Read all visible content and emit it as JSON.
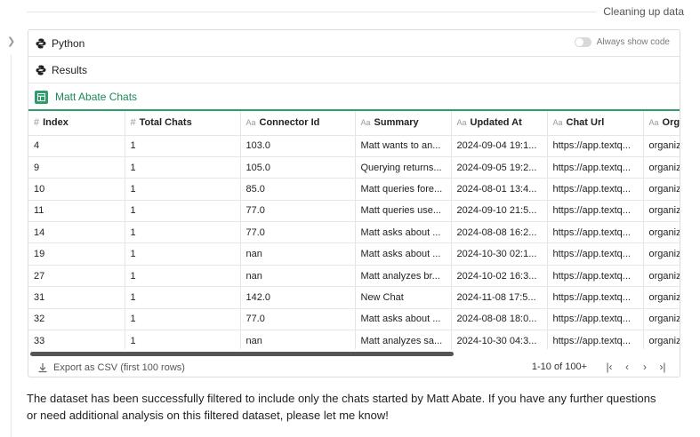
{
  "header": {
    "status": "Cleaning up data"
  },
  "cell": {
    "python_label": "Python",
    "results_label": "Results",
    "always_show_code_label": "Always show code",
    "always_show_code_on": false,
    "table_title": "Matt Abate Chats"
  },
  "table": {
    "columns": [
      {
        "type": "#",
        "label": "Index"
      },
      {
        "type": "#",
        "label": "Total Chats"
      },
      {
        "type": "Aa",
        "label": "Connector Id"
      },
      {
        "type": "Aa",
        "label": "Summary"
      },
      {
        "type": "Aa",
        "label": "Updated At"
      },
      {
        "type": "Aa",
        "label": "Chat Url"
      },
      {
        "type": "Aa",
        "label": "Org"
      }
    ],
    "rows": [
      [
        "4",
        "1",
        "103.0",
        "Matt wants to an...",
        "2024-09-04 19:1...",
        "https://app.textq...",
        "organiz"
      ],
      [
        "9",
        "1",
        "105.0",
        "Querying returns...",
        "2024-09-05 19:2...",
        "https://app.textq...",
        "organiz"
      ],
      [
        "10",
        "1",
        "85.0",
        "Matt queries fore...",
        "2024-08-01 13:4...",
        "https://app.textq...",
        "organiz"
      ],
      [
        "11",
        "1",
        "77.0",
        "Matt queries use...",
        "2024-09-10 21:5...",
        "https://app.textq...",
        "organiz"
      ],
      [
        "14",
        "1",
        "77.0",
        "Matt asks about ...",
        "2024-08-08 16:2...",
        "https://app.textq...",
        "organiz"
      ],
      [
        "19",
        "1",
        "nan",
        "Matt asks about ...",
        "2024-10-30 02:1...",
        "https://app.textq...",
        "organiz"
      ],
      [
        "27",
        "1",
        "nan",
        "Matt analyzes br...",
        "2024-10-02 16:3...",
        "https://app.textq...",
        "organiz"
      ],
      [
        "31",
        "1",
        "142.0",
        "New Chat",
        "2024-11-08 17:5...",
        "https://app.textq...",
        "organiz"
      ],
      [
        "32",
        "1",
        "77.0",
        "Matt asks about ...",
        "2024-08-08 18:0...",
        "https://app.textq...",
        "organiz"
      ],
      [
        "33",
        "1",
        "nan",
        "Matt analyzes sa...",
        "2024-10-30 04:3...",
        "https://app.textq...",
        "organiz"
      ]
    ]
  },
  "footer": {
    "export_label": "Export as CSV (first 100 rows)",
    "page_count": "1-10 of 100+"
  },
  "assistant_message": "The dataset has been successfully filtered to include only the chats started by Matt Abate. If you have any further questions or need additional analysis on this filtered dataset, please let me know!"
}
